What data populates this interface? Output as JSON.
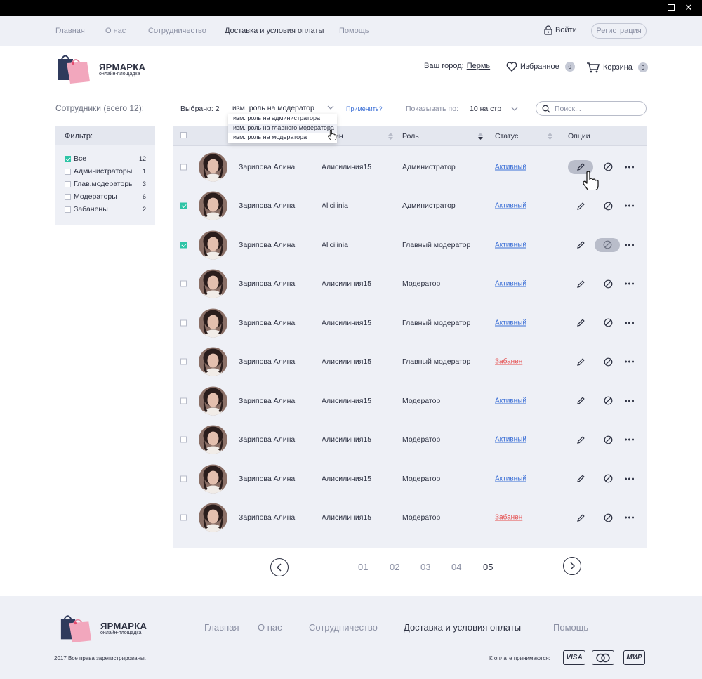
{
  "window": {
    "minimize_icon": "minimize-icon",
    "maximize_icon": "maximize-icon",
    "close_icon": "close-icon"
  },
  "topnav": {
    "links": [
      "Главная",
      "О нас",
      "Сотрудничество",
      "Доставка и условия оплаты",
      "Помощь"
    ],
    "active": "Доставка и условия оплаты",
    "login": "Войти",
    "register": "Регистрация"
  },
  "logo": {
    "brand": "ЯРМАРКА",
    "tagline": "онлайн-площадка"
  },
  "header": {
    "city_label": "Ваш город:",
    "city": "Пермь",
    "favorites": "Избранное",
    "favorites_count": "0",
    "cart": "Корзина",
    "cart_count": "0"
  },
  "section_title": "Сотрудники (всего 12):",
  "filter": {
    "title": "Фильтр:",
    "items": [
      {
        "label": "Все",
        "count": "12",
        "checked": true
      },
      {
        "label": "Администраторы",
        "count": "1",
        "checked": false
      },
      {
        "label": "Глав.модераторы",
        "count": "3",
        "checked": false
      },
      {
        "label": "Модераторы",
        "count": "6",
        "checked": false
      },
      {
        "label": "Забанены",
        "count": "2",
        "checked": false
      }
    ]
  },
  "toolbar": {
    "selected_label": "Выбрано: 2",
    "role_action": "изм. роль на модератор",
    "dropdown_options": [
      "изм. роль на администратора",
      "изм. роль на главного модератора",
      "изм. роль на модератора"
    ],
    "apply": "Применить?",
    "per_page_label": "Показывать по:",
    "per_page_value": "10 на стр",
    "search_placeholder": "Поиск..."
  },
  "table": {
    "columns": {
      "login": "Логин",
      "role": "Роль",
      "status": "Статус",
      "options": "Опции"
    },
    "login_header_visible": "ин",
    "rows": [
      {
        "name": "Зарипова Алина",
        "login": "Алисилиния15",
        "role": "Администратор",
        "status": "Активный",
        "status_type": "active",
        "checked": false
      },
      {
        "name": "Зарипова Алина",
        "login": "Alicilinia",
        "role": "Администратор",
        "status": "Активный",
        "status_type": "active",
        "checked": true
      },
      {
        "name": "Зарипова Алина",
        "login": "Alicilinia",
        "role": "Главный модератор",
        "status": "Активный",
        "status_type": "active",
        "checked": true
      },
      {
        "name": "Зарипова Алина",
        "login": "Алисилиния15",
        "role": "Модератор",
        "status": "Активный",
        "status_type": "active",
        "checked": false
      },
      {
        "name": "Зарипова Алина",
        "login": "Алисилиния15",
        "role": "Главный модератор",
        "status": "Активный",
        "status_type": "active",
        "checked": false
      },
      {
        "name": "Зарипова Алина",
        "login": "Алисилиния15",
        "role": "Главный модератор",
        "status": "Забанен",
        "status_type": "banned",
        "checked": false
      },
      {
        "name": "Зарипова Алина",
        "login": "Алисилиния15",
        "role": "Модератор",
        "status": "Активный",
        "status_type": "active",
        "checked": false
      },
      {
        "name": "Зарипова Алина",
        "login": "Алисилиния15",
        "role": "Модератор",
        "status": "Активный",
        "status_type": "active",
        "checked": false
      },
      {
        "name": "Зарипова Алина",
        "login": "Алисилиния15",
        "role": "Модератор",
        "status": "Активный",
        "status_type": "active",
        "checked": false
      },
      {
        "name": "Зарипова Алина",
        "login": "Алисилиния15",
        "role": "Модератор",
        "status": "Забанен",
        "status_type": "banned",
        "checked": false
      }
    ]
  },
  "pagination": {
    "pages": [
      "01",
      "02",
      "03",
      "04",
      "05"
    ],
    "current": "05"
  },
  "footer": {
    "links": [
      "Главная",
      "О нас",
      "Сотрудничество",
      "Доставка и условия оплаты",
      "Помощь"
    ],
    "active": "Доставка и условия оплаты",
    "copyright": "2017 Все права зарегистрированы.",
    "payment_label": "К оплате принимаются:",
    "cards": [
      "VISA",
      "MasterCard",
      "МИР"
    ],
    "cards_visible_text": [
      "VISA",
      "МИР"
    ]
  },
  "colors": {
    "accent_green": "#2ec4a6",
    "link_blue": "#3b6fd6",
    "banned_red": "#e54b4b",
    "panel": "#eef0f6",
    "bag_dark": "#2f3a5c",
    "bag_pink": "#f2a7bd"
  }
}
